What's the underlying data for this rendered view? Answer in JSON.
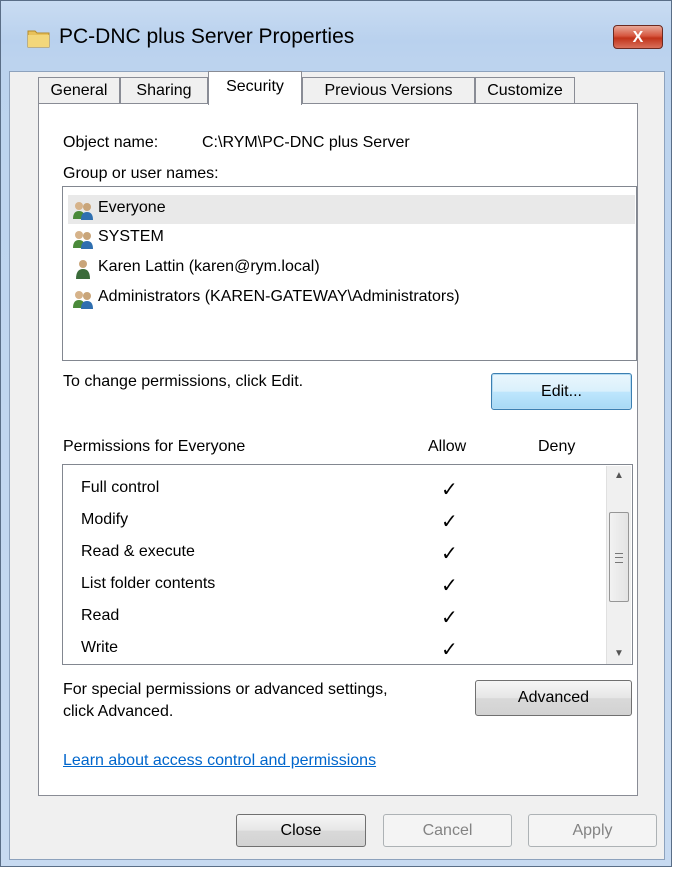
{
  "window": {
    "title": "PC-DNC plus Server Properties",
    "close_label": "X"
  },
  "tabs": [
    {
      "label": "General"
    },
    {
      "label": "Sharing"
    },
    {
      "label": "Security"
    },
    {
      "label": "Previous Versions"
    },
    {
      "label": "Customize"
    }
  ],
  "security": {
    "object_name_label": "Object name:",
    "object_name_value": "C:\\RYM\\PC-DNC plus Server",
    "group_label": "Group or user names:",
    "users": [
      {
        "name": "Everyone",
        "icon": "group-users-icon"
      },
      {
        "name": "SYSTEM",
        "icon": "group-users-icon"
      },
      {
        "name": "Karen Lattin (karen@rym.local)",
        "icon": "user-icon"
      },
      {
        "name": "Administrators (KAREN-GATEWAY\\Administrators)",
        "icon": "group-users-icon"
      }
    ],
    "change_text": "To change permissions, click Edit.",
    "edit_label": "Edit...",
    "permissions_for": "Permissions for Everyone",
    "allow_header": "Allow",
    "deny_header": "Deny",
    "permissions": [
      {
        "name": "Full control",
        "allow": "✓",
        "deny": ""
      },
      {
        "name": "Modify",
        "allow": "✓",
        "deny": ""
      },
      {
        "name": "Read & execute",
        "allow": "✓",
        "deny": ""
      },
      {
        "name": "List folder contents",
        "allow": "✓",
        "deny": ""
      },
      {
        "name": "Read",
        "allow": "✓",
        "deny": ""
      },
      {
        "name": "Write",
        "allow": "✓",
        "deny": ""
      }
    ],
    "special_text_1": "For special permissions or advanced settings,",
    "special_text_2": "click Advanced.",
    "advanced_label": "Advanced",
    "learn_link": "Learn about access control and permissions"
  },
  "footer": {
    "close_label": "Close",
    "cancel_label": "Cancel",
    "apply_label": "Apply"
  }
}
